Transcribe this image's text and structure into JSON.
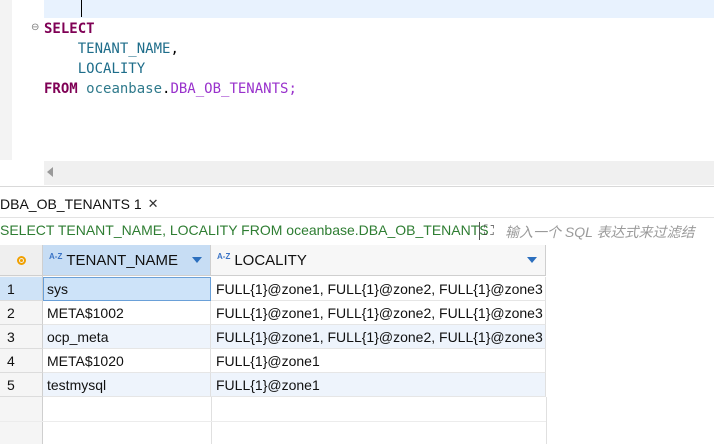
{
  "editor": {
    "fold_marker": "⊖",
    "lines": {
      "l1_kw": "SELECT",
      "l2_ident": "TENANT_NAME",
      "l2_punct": ",",
      "l3_ident": "LOCALITY",
      "l4_kw": "FROM",
      "l4_schema": "oceanbase",
      "l4_dot": ".",
      "l4_table": "DBA_OB_TENANTS",
      "l4_semicolon": ";"
    }
  },
  "result_tab": {
    "label": "DBA_OB_TENANTS 1",
    "close": "✕"
  },
  "filter": {
    "query_text": "SELECT TENANT_NAME, LOCALITY FROM oceanbase.DBA_OB_TENANTS",
    "expand_icon": "⛶",
    "placeholder": "输入一个 SQL 表达式来过滤结"
  },
  "grid": {
    "sort_badge": "A-Z",
    "columns": [
      "TENANT_NAME",
      "LOCALITY"
    ],
    "rows": [
      {
        "num": "1",
        "tenant_name": "sys",
        "locality": "FULL{1}@zone1, FULL{1}@zone2, FULL{1}@zone3"
      },
      {
        "num": "2",
        "tenant_name": "META$1002",
        "locality": "FULL{1}@zone1, FULL{1}@zone2, FULL{1}@zone3"
      },
      {
        "num": "3",
        "tenant_name": "ocp_meta",
        "locality": "FULL{1}@zone1, FULL{1}@zone2, FULL{1}@zone3"
      },
      {
        "num": "4",
        "tenant_name": "META$1020",
        "locality": "FULL{1}@zone1"
      },
      {
        "num": "5",
        "tenant_name": "testmysql",
        "locality": "FULL{1}@zone1"
      }
    ]
  },
  "colors": {
    "keyword": "#7f0055",
    "identifier": "#1e6d8a",
    "table_ref": "#9932cc",
    "query_text": "#2e7d32",
    "selected_header": "#c7ddf4"
  }
}
